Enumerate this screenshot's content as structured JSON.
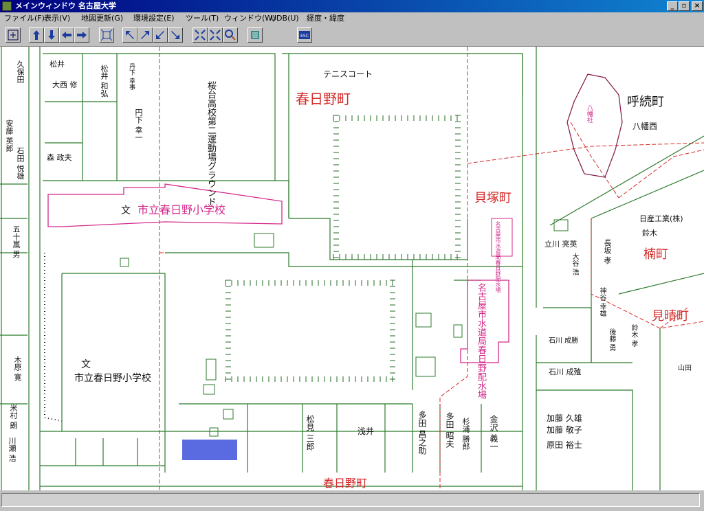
{
  "window": {
    "title": "メインウィンドウ 名古屋大学",
    "minimize": "_",
    "restore": "▫",
    "close": "×"
  },
  "menu": [
    "ファイル(F)",
    "表示(V)",
    "地図更新(G)",
    "環境設定(E)",
    "ツール(T)",
    "ウィンドウ(W)",
    "UDB(U)",
    "経度・緯度"
  ],
  "toolbar": {
    "icons": [
      "up-arrow-icon",
      "down-arrow-icon",
      "left-arrow-icon",
      "right-arrow-icon",
      "fit-view-icon",
      "arrow-up-left-icon",
      "arrow-up-right-icon",
      "arrow-down-left-icon",
      "arrow-down-right-icon",
      "zoom-in-icon",
      "zoom-out-icon",
      "magnifier-icon",
      "layers-icon",
      "escape-icon"
    ],
    "esc_label": "ESC"
  },
  "map": {
    "towns": [
      "春日野町",
      "貝塚町",
      "呼続町",
      "楠町",
      "見晴町",
      "春日野町"
    ],
    "facilities": {
      "school_top": "市立春日野小学校",
      "school_bottom": "市立春日野小学校",
      "school_symbol": "文",
      "tennis": "テニスコート",
      "ground": "桜台高校第二運動場グラウンド",
      "water": "名古屋市水道局春日野配水場",
      "water_small": "名古屋市水道局春日野配水場",
      "hachiman": "八幡西",
      "shrine": "八幡社"
    },
    "houses": [
      "松井",
      "松井 和弘",
      "大西 修",
      "森 政夫",
      "円下 幸一",
      "丹下 幸事",
      "立川 亮英",
      "長坂 孝",
      "日産工業(株)",
      "鈴木",
      "石川 成勝",
      "石川 成殖",
      "加藤 久雄",
      "加藤 敬子",
      "原田 裕士",
      "松見 三郎",
      "浅井",
      "多田 昌之助",
      "多田 昭夫",
      "杉浦 勝郎",
      "金沢 義一",
      "山田",
      "安藤 英郎",
      "米村 朗",
      "川瀬 浩",
      "木原 寛",
      "石田 悦雄",
      "大谷 浩",
      "神谷 幸雄",
      "後藤 勇",
      "鈴木 孝",
      "久保田",
      "五十嵐 男"
    ]
  }
}
